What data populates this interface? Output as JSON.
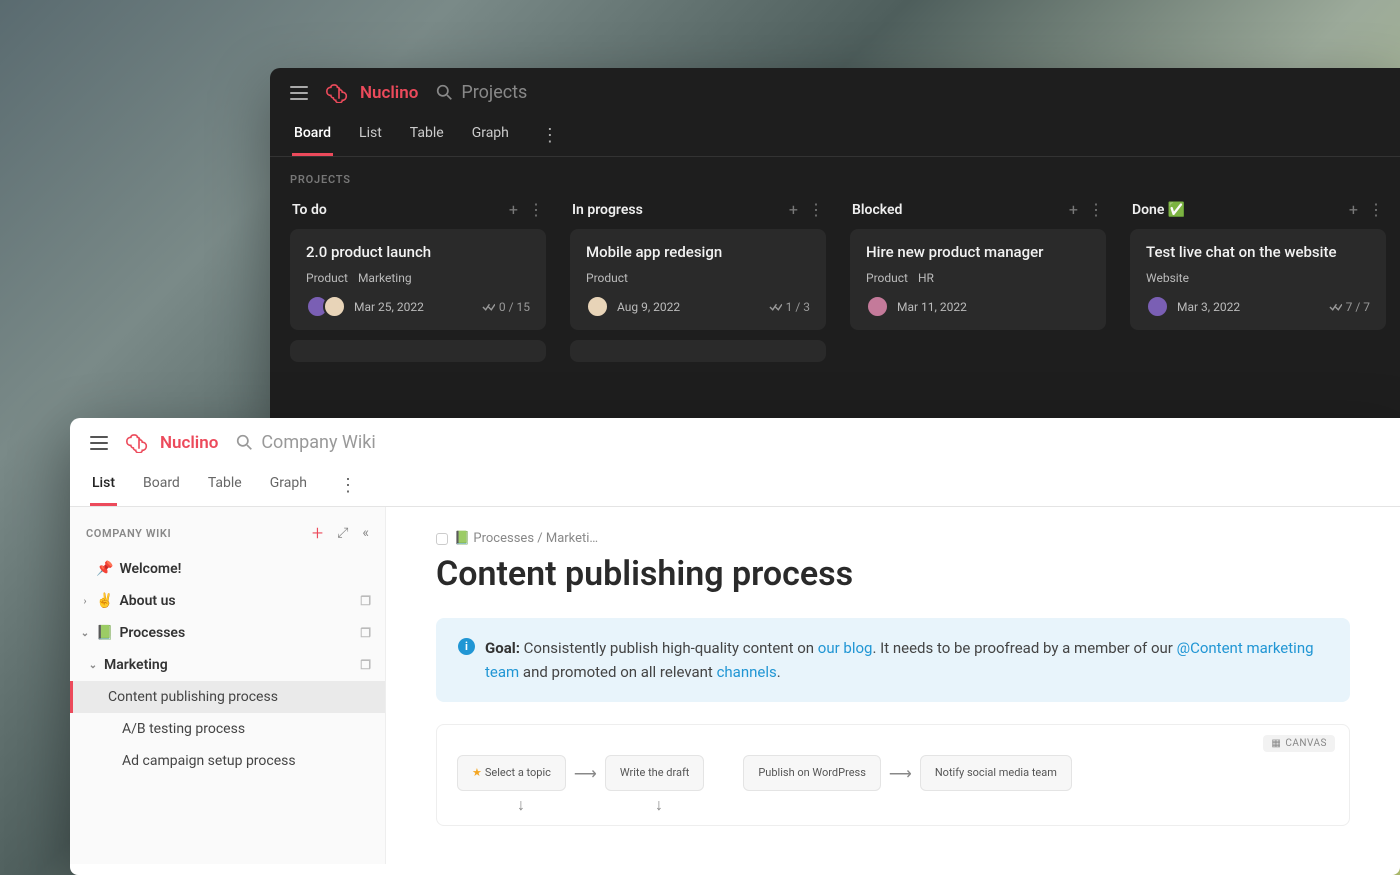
{
  "brand": "Nuclino",
  "dark_window": {
    "search_placeholder": "Projects",
    "tabs": [
      "Board",
      "List",
      "Table",
      "Graph"
    ],
    "active_tab": "Board",
    "section": "PROJECTS",
    "columns": [
      {
        "title": "To do",
        "cards": [
          {
            "title": "2.0 product launch",
            "tags": [
              "Product",
              "Marketing"
            ],
            "date": "Mar 25, 2022",
            "count": "0 / 15",
            "avatars": 2
          }
        ]
      },
      {
        "title": "In progress",
        "cards": [
          {
            "title": "Mobile app redesign",
            "tags": [
              "Product"
            ],
            "date": "Aug 9, 2022",
            "count": "1 / 3",
            "avatars": 1
          }
        ]
      },
      {
        "title": "Blocked",
        "cards": [
          {
            "title": "Hire new product manager",
            "tags": [
              "Product",
              "HR"
            ],
            "date": "Mar 11, 2022",
            "count": "",
            "avatars": 1
          }
        ]
      },
      {
        "title": "Done ✅",
        "cards": [
          {
            "title": "Test live chat on the website",
            "tags": [
              "Website"
            ],
            "date": "Mar 3, 2022",
            "count": "7 / 7",
            "avatars": 1
          }
        ]
      }
    ]
  },
  "light_window": {
    "search_placeholder": "Company Wiki",
    "tabs": [
      "List",
      "Board",
      "Table",
      "Graph"
    ],
    "active_tab": "List",
    "sidebar_title": "COMPANY WIKI",
    "tree": {
      "welcome": "Welcome!",
      "about": "About us",
      "processes": "Processes",
      "marketing": "Marketing",
      "items": [
        "Content publishing process",
        "A/B testing process",
        "Ad campaign setup process"
      ]
    },
    "breadcrumb": "📗 Processes / Marketi…",
    "page_title": "Content publishing process",
    "goal": {
      "label": "Goal:",
      "text1": " Consistently publish high-quality content on ",
      "link1": "our blog",
      "text2": ". It needs to be proofread by a member of our ",
      "link2": "@Content marketing team",
      "text3": " and promoted on all relevant ",
      "link3": "channels",
      "text4": "."
    },
    "canvas_label": "CANVAS",
    "flow": [
      "Select a topic",
      "Write the draft",
      "Publish on WordPress",
      "Notify social media team"
    ]
  }
}
